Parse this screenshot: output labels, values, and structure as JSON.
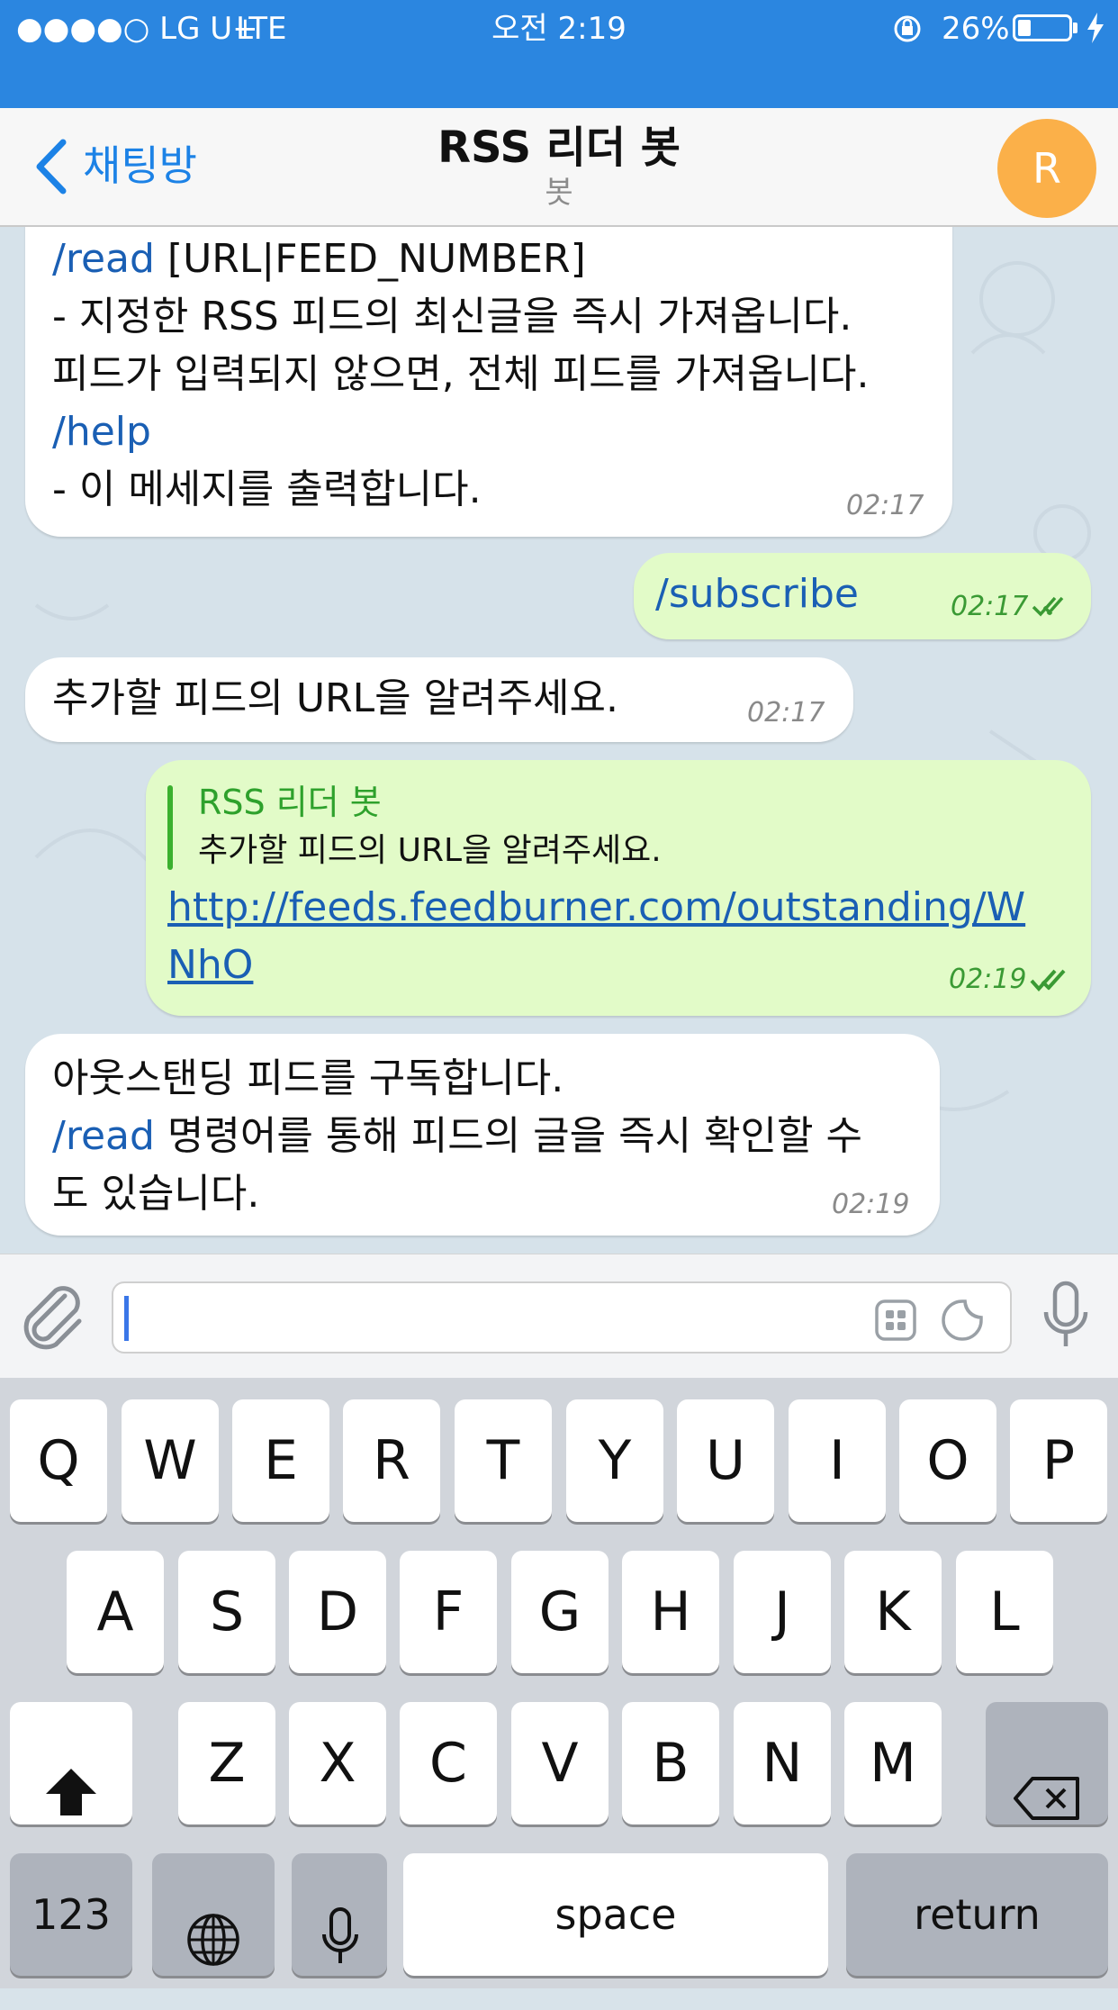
{
  "status_bar": {
    "carrier": "●●●●○ LG U+",
    "network": "LTE",
    "time": "오전 2:19",
    "battery": "26%",
    "battery_level": 0.26
  },
  "nav": {
    "back_label": "채팅방",
    "title": "RSS 리더 봇",
    "subtitle": "봇",
    "avatar_letter": "R"
  },
  "messages": {
    "m1": {
      "cmd_read": "/read",
      "read_args": " [URL|FEED_NUMBER]",
      "line2": "- 지정한 RSS 피드의 최신글을 즉시 가져옵니다.",
      "line3": "피드가 입력되지 않으면, 전체 피드를 가져옵니다.",
      "cmd_help": "/help",
      "line5": "- 이 메세지를 출력합니다.",
      "time": "02:17"
    },
    "m2": {
      "text": "/subscribe",
      "time": "02:17"
    },
    "m3": {
      "text": "추가할 피드의 URL을 알려주세요.",
      "time": "02:17"
    },
    "m4": {
      "quote_name": "RSS 리더 봇",
      "quote_text": "추가할 피드의 URL을 알려주세요.",
      "link_line1": "http://feeds.feedburner.com/outstanding/W",
      "link_line2": "NhO",
      "time": "02:19"
    },
    "m5": {
      "line1": "아웃스탠딩 피드를 구독합니다.",
      "cmd_read": "/read",
      "line2_rest": " 명령어를 통해 피드의 글을 즉시 확인할 수",
      "line3": "도 있습니다.",
      "time": "02:19"
    }
  },
  "input": {
    "value": ""
  },
  "keyboard": {
    "row1": [
      "Q",
      "W",
      "E",
      "R",
      "T",
      "Y",
      "U",
      "I",
      "O",
      "P"
    ],
    "row2": [
      "A",
      "S",
      "D",
      "F",
      "G",
      "H",
      "J",
      "K",
      "L"
    ],
    "row3": [
      "Z",
      "X",
      "C",
      "V",
      "B",
      "N",
      "M"
    ],
    "numbers_label": "123",
    "space_label": "space",
    "return_label": "return"
  },
  "colors": {
    "status_bar": "#2b86e0",
    "accent": "#1c82e6",
    "outgoing_bubble": "#e2fbc8",
    "avatar": "#fbb049"
  }
}
